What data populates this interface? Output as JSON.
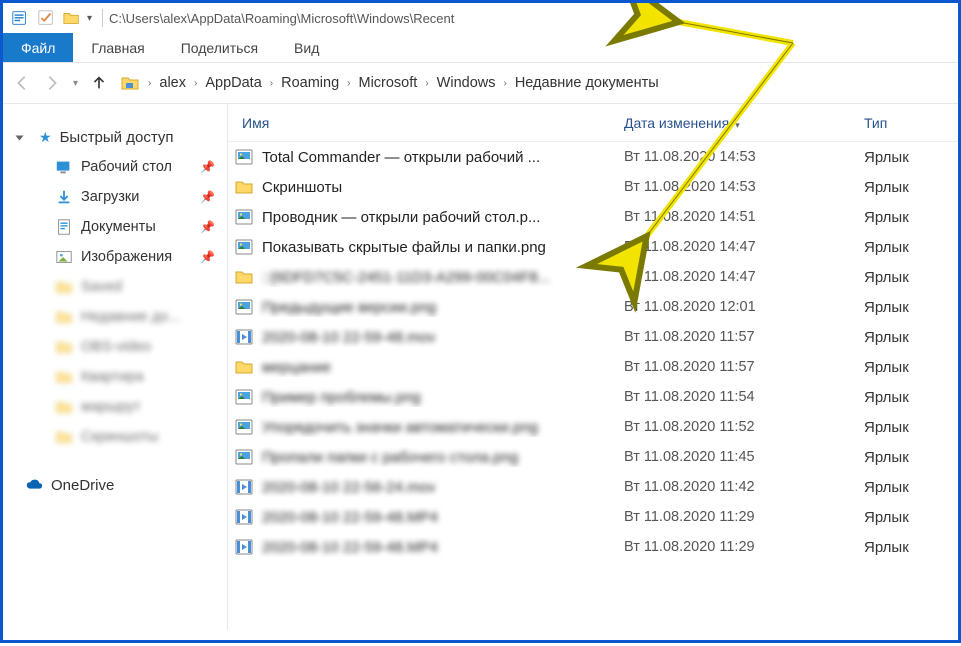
{
  "titlebar": {
    "path": "C:\\Users\\alex\\AppData\\Roaming\\Microsoft\\Windows\\Recent"
  },
  "ribbon": {
    "file": "Файл",
    "home": "Главная",
    "share": "Поделиться",
    "view": "Вид"
  },
  "breadcrumb": [
    "alex",
    "AppData",
    "Roaming",
    "Microsoft",
    "Windows",
    "Недавние документы"
  ],
  "sidebar": {
    "quick_access": "Быстрый доступ",
    "desktop": "Рабочий стол",
    "downloads": "Загрузки",
    "documents": "Документы",
    "pictures": "Изображения",
    "blur1": "Saved",
    "blur2": "Недавние до...",
    "blur3": "OBS-video",
    "blur4": "Квартира",
    "blur5": "маршрут",
    "blur6": "Скриншоты",
    "onedrive": "OneDrive"
  },
  "columns": {
    "name": "Имя",
    "date": "Дата изменения",
    "type": "Тип"
  },
  "type_shortcut": "Ярлык",
  "rows": [
    {
      "icon": "img",
      "name": "Total Commander — открыли рабочий ...",
      "date": "Вт 11.08.2020 14:53",
      "blurred": false
    },
    {
      "icon": "folder",
      "name": "Скриншоты",
      "date": "Вт 11.08.2020 14:53",
      "blurred": false
    },
    {
      "icon": "img",
      "name": "Проводник — открыли рабочий стол.p...",
      "date": "Вт 11.08.2020 14:51",
      "blurred": false
    },
    {
      "icon": "img",
      "name": "Показывать скрытые файлы и папки.png",
      "date": "Вт 11.08.2020 14:47",
      "blurred": false
    },
    {
      "icon": "folder",
      "name": "::{6DFD7C5C-2451-11D3-A299-00C04F8...",
      "date": "Вт 11.08.2020 14:47",
      "blurred": true
    },
    {
      "icon": "img",
      "name": "Предыдущие версии.png",
      "date": "Вт 11.08.2020 12:01",
      "blurred": true
    },
    {
      "icon": "video",
      "name": "2020-08-10 22-59-48.mov",
      "date": "Вт 11.08.2020 11:57",
      "blurred": true
    },
    {
      "icon": "folder",
      "name": "мерцание",
      "date": "Вт 11.08.2020 11:57",
      "blurred": true
    },
    {
      "icon": "img",
      "name": "Пример проблемы.png",
      "date": "Вт 11.08.2020 11:54",
      "blurred": true
    },
    {
      "icon": "img",
      "name": "Упорядочить значки автоматически.png",
      "date": "Вт 11.08.2020 11:52",
      "blurred": true
    },
    {
      "icon": "img",
      "name": "Пропали папки с рабочего стола.png",
      "date": "Вт 11.08.2020 11:45",
      "blurred": true
    },
    {
      "icon": "video",
      "name": "2020-08-10 22-56-24.mov",
      "date": "Вт 11.08.2020 11:42",
      "blurred": true
    },
    {
      "icon": "video",
      "name": "2020-08-10 22-59-48.MP4",
      "date": "Вт 11.08.2020 11:29",
      "blurred": true
    },
    {
      "icon": "video",
      "name": "2020-08-10 22-59-48.MP4",
      "date": "Вт 11.08.2020 11:29",
      "blurred": true
    }
  ]
}
